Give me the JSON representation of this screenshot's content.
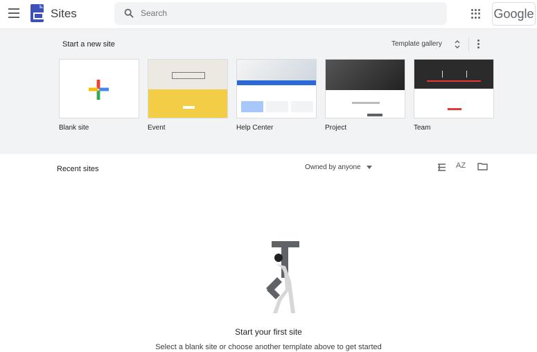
{
  "header": {
    "app_title": "Sites",
    "search_placeholder": "Search",
    "brand": "Google"
  },
  "templates": {
    "title": "Start a new site",
    "gallery_label": "Template gallery",
    "items": [
      {
        "label": "Blank site"
      },
      {
        "label": "Event"
      },
      {
        "label": "Help Center"
      },
      {
        "label": "Project"
      },
      {
        "label": "Team"
      }
    ]
  },
  "recent": {
    "title": "Recent sites",
    "owner_filter": "Owned by anyone",
    "view_sort_label": "AZ",
    "empty_title": "Start your first site",
    "empty_message": "Select a blank site or choose another template above to get started"
  },
  "icons": [
    "menu-icon",
    "sites-logo-icon",
    "search-icon",
    "apps-icon",
    "sort-icon",
    "more-icon",
    "plus-icon",
    "list-view-icon",
    "sort-az-icon",
    "folder-icon"
  ],
  "colors": {
    "sites_blue": "#4051b5",
    "page_bg": "#f1f3f4"
  }
}
